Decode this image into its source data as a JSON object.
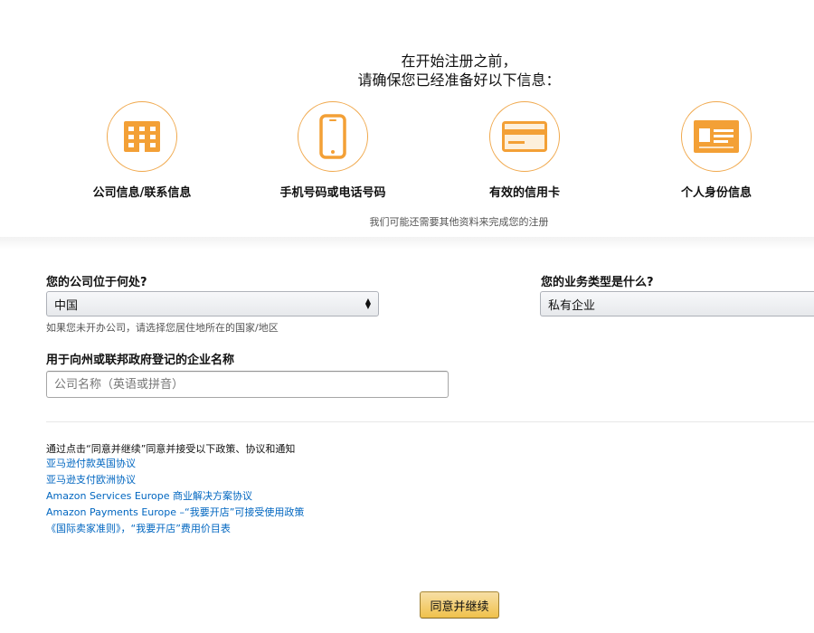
{
  "intro": {
    "line1": "在开始注册之前，",
    "line2": "请确保您已经准备好以下信息："
  },
  "requirements": [
    {
      "label": "公司信息/联系信息",
      "icon": "building-icon"
    },
    {
      "label": "手机号码或电话号码",
      "icon": "mobile-phone-icon"
    },
    {
      "label": "有效的信用卡",
      "icon": "credit-card-icon"
    },
    {
      "label": "个人身份信息",
      "icon": "id-card-icon"
    }
  ],
  "requirements_note": "我们可能还需要其他资料来完成您的注册",
  "company_location": {
    "label": "您的公司位于何处?",
    "selected": "中国",
    "hint": "如果您未开办公司，请选择您居住地所在的国家/地区"
  },
  "business_type": {
    "label": "您的业务类型是什么?",
    "selected": "私有企业"
  },
  "company_name": {
    "label": "用于向州或联邦政府登记的企业名称",
    "value": "",
    "placeholder": "公司名称（英语或拼音）"
  },
  "policies": {
    "intro": "通过点击“同意并继续”同意并接受以下政策、协议和通知",
    "links": [
      "亚马逊付款英国协议",
      "亚马逊支付欧洲协议",
      "Amazon Services Europe 商业解决方案协议",
      "Amazon Payments Europe –“我要开店”可接受使用政策",
      "《国际卖家准则》，“我要开店”费用价目表"
    ]
  },
  "continue_label": "同意并继续",
  "colors": {
    "accent_orange": "#f0a84c",
    "icon_orange": "#f3a036",
    "link_blue": "#0066c0",
    "button_yellow": "#f0c14b"
  }
}
